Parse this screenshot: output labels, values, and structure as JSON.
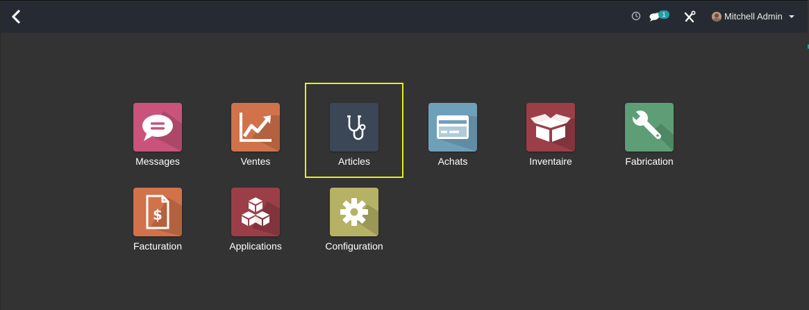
{
  "navbar": {
    "back_icon": "chevron-left-icon",
    "clock_icon": "clock-icon",
    "chat_icon": "chat-icon",
    "chat_badge": "1",
    "tools_icon": "tools-icon",
    "user_name": "Mitchell Admin",
    "bg": "#262b33",
    "badge_color": "#1ea0a5"
  },
  "apps": [
    {
      "label": "Messages",
      "icon": "chat-bubble-icon",
      "color": "#c9537a"
    },
    {
      "label": "Ventes",
      "icon": "trend-chart-icon",
      "color": "#d1724a"
    },
    {
      "label": "Articles",
      "icon": "stethoscope-icon",
      "color": "#3b4656"
    },
    {
      "label": "Achats",
      "icon": "credit-card-icon",
      "color": "#6fa0ba"
    },
    {
      "label": "Inventaire",
      "icon": "open-box-icon",
      "color": "#9b3e48"
    },
    {
      "label": "Fabrication",
      "icon": "wrench-icon",
      "color": "#5d9e76"
    },
    {
      "label": "Facturation",
      "icon": "invoice-icon",
      "color": "#d1724a"
    },
    {
      "label": "Applications",
      "icon": "cubes-icon",
      "color": "#9b3e48"
    },
    {
      "label": "Configuration",
      "icon": "gear-icon",
      "color": "#b5b266"
    }
  ],
  "highlight_color": "#e6ef20",
  "background": "#333333"
}
